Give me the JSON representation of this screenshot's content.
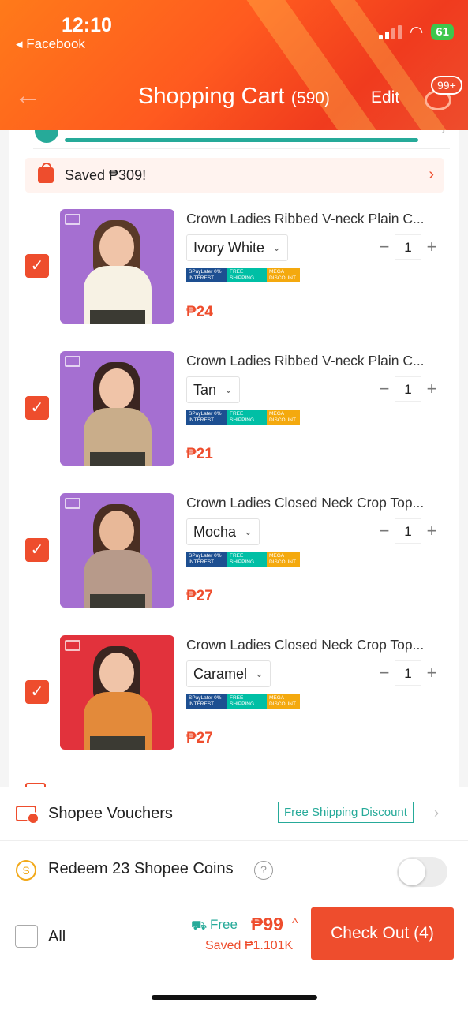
{
  "status_bar": {
    "time": "12:10",
    "back_app": "◂ Facebook",
    "battery": "61"
  },
  "header": {
    "title": "Shopping Cart",
    "count": "(590)",
    "edit_label": "Edit",
    "chat_badge": "99+",
    "color": "#ee4d2d"
  },
  "cart": {
    "saved_banner": "Saved ₱309!",
    "items": [
      {
        "name": "Crown Ladies Ribbed V-neck Plain C...",
        "variant": "Ivory White",
        "quantity": "1",
        "price": "₱24",
        "badges": [
          "SPayLater 0% INTEREST",
          "FREE SHIPPING",
          "MEGA DISCOUNT"
        ],
        "bg_color": "#a56fd1",
        "top_color": "#f7f2e4"
      },
      {
        "name": "Crown Ladies Ribbed V-neck Plain C...",
        "variant": "Tan",
        "quantity": "1",
        "price": "₱21",
        "badges": [
          "SPayLater 0% INTEREST",
          "FREE SHIPPING",
          "MEGA DISCOUNT"
        ],
        "bg_color": "#a56fd1",
        "top_color": "#c9ad8a"
      },
      {
        "name": "Crown Ladies Closed Neck Crop Top...",
        "variant": "Mocha",
        "quantity": "1",
        "price": "₱27",
        "badges": [
          "SPayLater 0% INTEREST",
          "FREE SHIPPING",
          "MEGA DISCOUNT"
        ],
        "bg_color": "#a56fd1",
        "top_color": "#b79a8a"
      },
      {
        "name": "Crown Ladies Closed Neck Crop Top...",
        "variant": "Caramel",
        "quantity": "1",
        "price": "₱27",
        "badges": [
          "SPayLater 0% INTEREST",
          "FREE SHIPPING",
          "MEGA DISCOUNT"
        ],
        "bg_color": "#e2323c",
        "top_color": "#e38a3a"
      }
    ]
  },
  "bottom": {
    "vouchers_label": "Shopee Vouchers",
    "vouchers_tag": "Free Shipping Discount",
    "coins_label": "Redeem 23 Shopee Coins",
    "all_label": "All",
    "free_label": "Free",
    "total": "₱99",
    "saved": "Saved ₱1.101K",
    "checkout_label": "Check Out (4)"
  }
}
